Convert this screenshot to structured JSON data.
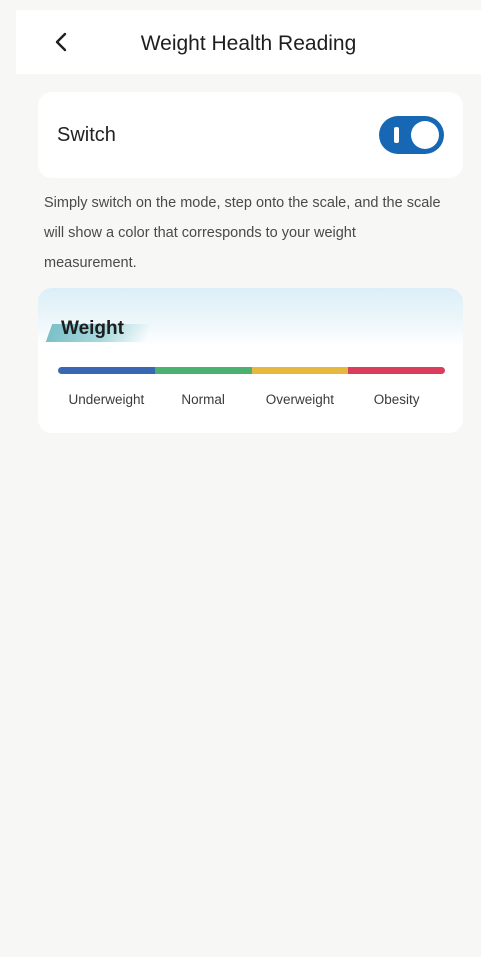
{
  "header": {
    "title": "Weight Health Reading",
    "back_icon": "chevron-left-icon"
  },
  "switch_card": {
    "label": "Switch",
    "toggle_on": true,
    "toggle_color": "#1668b5"
  },
  "description": "Simply switch on the mode, step onto the scale, and the scale will show a color that corresponds to your weight measurement.",
  "weight_card": {
    "title": "Weight",
    "categories": [
      {
        "label": "Underweight",
        "color": "#3a67b1"
      },
      {
        "label": "Normal",
        "color": "#4cb170"
      },
      {
        "label": "Overweight",
        "color": "#e6b83b"
      },
      {
        "label": "Obesity",
        "color": "#db3e5c"
      }
    ]
  }
}
